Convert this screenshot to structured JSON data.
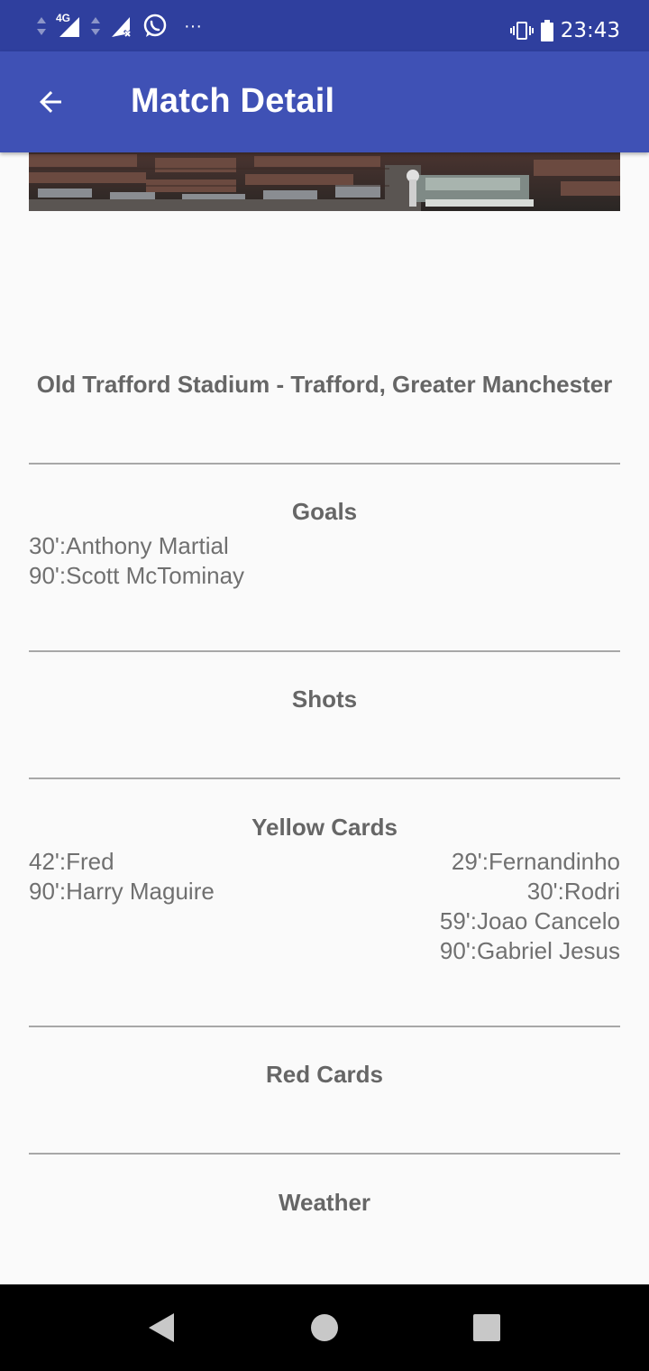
{
  "status_bar": {
    "network_type": "4G",
    "time": "23:43",
    "icons": [
      "data-transfer-icon",
      "signal-icon",
      "signal-no-sim-icon",
      "whatsapp-icon",
      "more-notifications-icon",
      "vibrate-icon",
      "battery-icon"
    ]
  },
  "app_bar": {
    "title": "Match Detail",
    "back_icon": "arrow-back-icon"
  },
  "match": {
    "venue": "Old Trafford Stadium - Trafford, Greater Manchester"
  },
  "sections": {
    "goals": {
      "title": "Goals",
      "home": [
        "30':Anthony Martial",
        "90':Scott McTominay"
      ],
      "away": []
    },
    "shots": {
      "title": "Shots",
      "home": [],
      "away": []
    },
    "yellow_cards": {
      "title": "Yellow Cards",
      "home": [
        "42':Fred",
        "90':Harry Maguire"
      ],
      "away": [
        "29':Fernandinho",
        "30':Rodri",
        "59':Joao Cancelo",
        "90':Gabriel Jesus"
      ]
    },
    "red_cards": {
      "title": "Red Cards",
      "home": [],
      "away": []
    },
    "weather": {
      "title": "Weather"
    }
  },
  "nav_bar": {
    "icons": [
      "nav-back-icon",
      "nav-home-icon",
      "nav-recents-icon"
    ]
  },
  "colors": {
    "status_bar": "#2f3f9e",
    "app_bar": "#3f51b5",
    "background": "#fafafa",
    "text": "#666666",
    "divider": "#a8a8a8"
  }
}
